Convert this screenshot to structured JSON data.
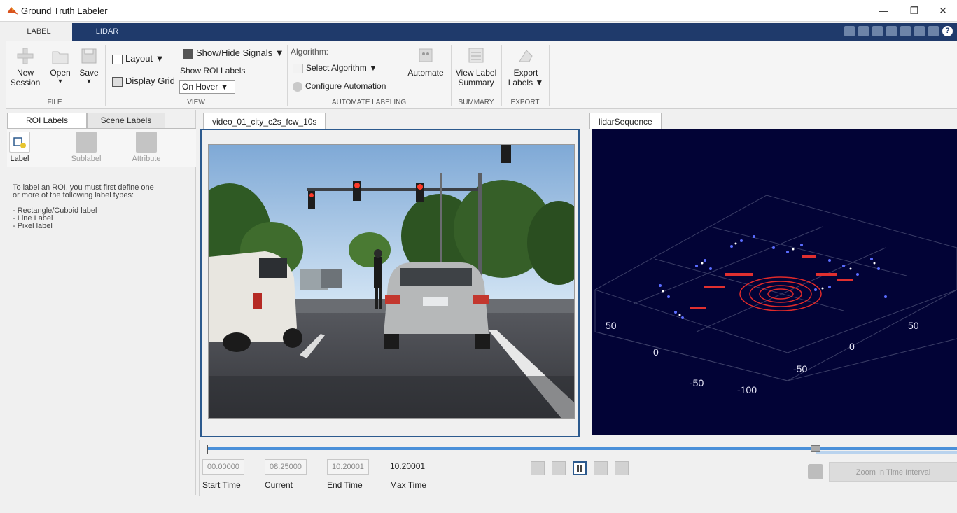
{
  "window": {
    "title": "Ground Truth Labeler",
    "minimize": "—",
    "restore": "❐",
    "close": "✕"
  },
  "tabs": [
    {
      "label": "LABEL"
    },
    {
      "label": "LIDAR"
    }
  ],
  "ribbon": {
    "file": {
      "new_session_1": "New",
      "new_session_2": "Session",
      "open": "Open",
      "save": "Save",
      "group": "FILE"
    },
    "view": {
      "layout": "Layout ▼",
      "display_grid": "Display Grid",
      "show_hide_signals": "Show/Hide Signals ▼",
      "show_roi_labels": "Show ROI Labels",
      "on_hover": "On Hover ▼",
      "group": "VIEW"
    },
    "automate": {
      "algorithm": "Algorithm:",
      "select_algorithm": "Select Algorithm ▼",
      "configure": "Configure Automation",
      "automate": "Automate",
      "group": "AUTOMATE LABELING"
    },
    "summary": {
      "view_label_1": "View Label",
      "view_label_2": "Summary",
      "group": "SUMMARY"
    },
    "export": {
      "export_1": "Export",
      "export_2": "Labels ▼",
      "group": "EXPORT"
    }
  },
  "left_panel": {
    "tabs": [
      "ROI Labels",
      "Scene Labels"
    ],
    "tools": [
      "Label",
      "Sublabel",
      "Attribute"
    ],
    "help": "To label an ROI, you must first define one\nor more of the following label types:\n\n- Rectangle/Cuboid label\n- Line Label\n- Pixel label"
  },
  "video_panel": {
    "tab": "video_01_city_c2s_fcw_10s"
  },
  "lidar_panel": {
    "tab": "lidarSequence",
    "axis_labels": [
      "50",
      "0",
      "-50",
      "50",
      "0",
      "-50",
      "-100"
    ]
  },
  "timeline": {
    "start_time": {
      "value": "00.00000",
      "label": "Start Time"
    },
    "current": {
      "value": "08.25000",
      "label": "Current"
    },
    "end_time": {
      "value": "10.20001",
      "label": "End Time"
    },
    "max_time": {
      "value": "10.20001",
      "label": "Max Time"
    },
    "progress_fraction": 0.81,
    "zoom_button": "Zoom In Time Interval"
  },
  "colors": {
    "accent": "#1f3a6b",
    "highlight": "#2c5a8e",
    "lidar_bg": "#020336"
  }
}
